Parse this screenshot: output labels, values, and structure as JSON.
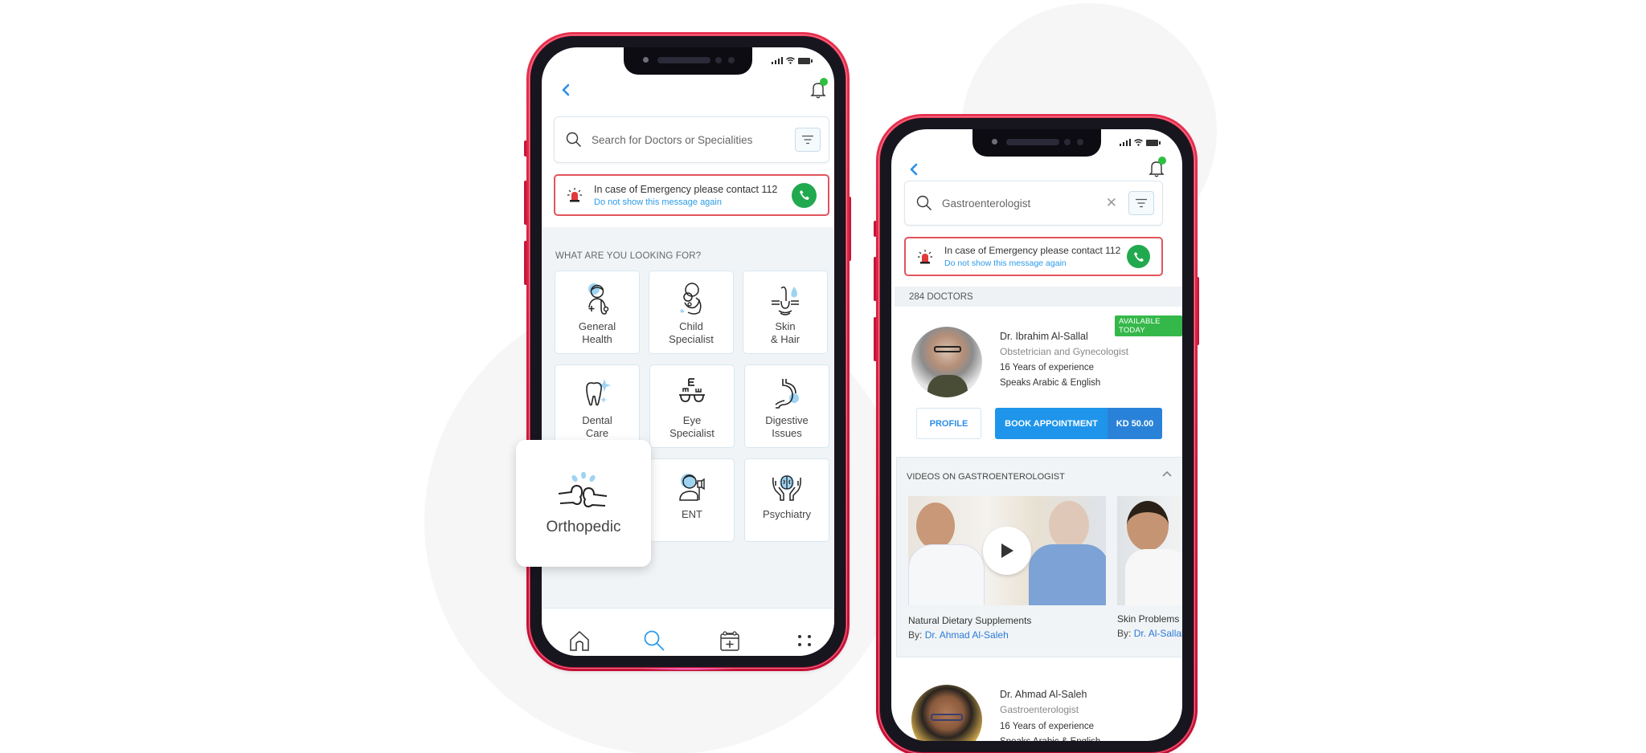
{
  "background": {
    "accent": "#f6f6f7"
  },
  "colors": {
    "frame": "#d21c3e",
    "primary": "#1e95ea",
    "link": "#2b9be8",
    "call": "#21a94f",
    "available": "#35b84a",
    "emergency_border": "#e2545c"
  },
  "left_phone": {
    "status_bar": {
      "icons": [
        "signal-icon",
        "wifi-icon",
        "battery-icon"
      ]
    },
    "header": {
      "back_icon": "chevron-left-icon",
      "notification_icon": "bell-icon",
      "has_notification": true
    },
    "search": {
      "placeholder": "Search for Doctors or Specialities",
      "value": ""
    },
    "emergency": {
      "message": "In case of Emergency please contact 112",
      "dismiss_link": "Do not show this message again",
      "icon": "siren-icon",
      "call_icon": "phone-icon"
    },
    "section_title": "WHAT ARE YOU LOOKING FOR?",
    "categories": [
      {
        "label": "General\nHealth",
        "icon": "doctor-icon"
      },
      {
        "label": "Child\nSpecialist",
        "icon": "mother-child-icon"
      },
      {
        "label": "Skin\n& Hair",
        "icon": "hair-follicle-icon"
      },
      {
        "label": "Dental\nCare",
        "icon": "tooth-icon"
      },
      {
        "label": "Eye\nSpecialist",
        "icon": "eye-chart-icon"
      },
      {
        "label": "Digestive\nIssues",
        "icon": "stomach-icon"
      },
      {
        "label": "Orthopedic",
        "icon": "bone-joint-icon"
      },
      {
        "label": "ENT",
        "icon": "ent-icon"
      },
      {
        "label": "Psychiatry",
        "icon": "brain-hands-icon"
      }
    ],
    "highlighted_category": {
      "label": "Orthopedic",
      "icon": "bone-joint-icon"
    },
    "bottom_nav": [
      {
        "name": "home",
        "icon": "home-icon",
        "active": false
      },
      {
        "name": "search",
        "icon": "search-icon",
        "active": true
      },
      {
        "name": "appointments",
        "icon": "calendar-add-icon",
        "active": false
      },
      {
        "name": "more",
        "icon": "grid-dots-icon",
        "active": false
      }
    ]
  },
  "right_phone": {
    "status_bar": {
      "icons": [
        "signal-icon",
        "wifi-icon",
        "battery-icon"
      ]
    },
    "header": {
      "back_icon": "chevron-left-icon",
      "notification_icon": "bell-icon",
      "has_notification": true
    },
    "search": {
      "value": "Gastroenterologist",
      "clear_icon": "close-icon"
    },
    "emergency": {
      "message": "In case of Emergency please contact 112",
      "dismiss_link": "Do not show this message again"
    },
    "results_count": "284 DOCTORS",
    "doctors": [
      {
        "name": "Dr. Ibrahim Al-Sallal",
        "specialty": "Obstetrician and Gynecologist",
        "experience": "16 Years of experience",
        "languages": "Speaks Arabic & English",
        "badge": "AVAILABLE TODAY",
        "profile_label": "PROFILE",
        "book_label": "BOOK APPOINTMENT",
        "price": "KD 50.00"
      },
      {
        "name": "Dr. Ahmad Al-Saleh",
        "specialty": "Gastroenterologist",
        "experience": "16 Years of experience",
        "languages": "Speaks Arabic & English"
      }
    ],
    "videos": {
      "title": "VIDEOS ON GASTROENTEROLOGIST",
      "items": [
        {
          "title": "Natural Dietary Supplements",
          "by_label": "By:",
          "author": "Dr. Ahmad Al-Saleh"
        },
        {
          "title": "Skin Problems",
          "by_label": "By:",
          "author": "Dr. Al-Sallal"
        }
      ]
    }
  }
}
